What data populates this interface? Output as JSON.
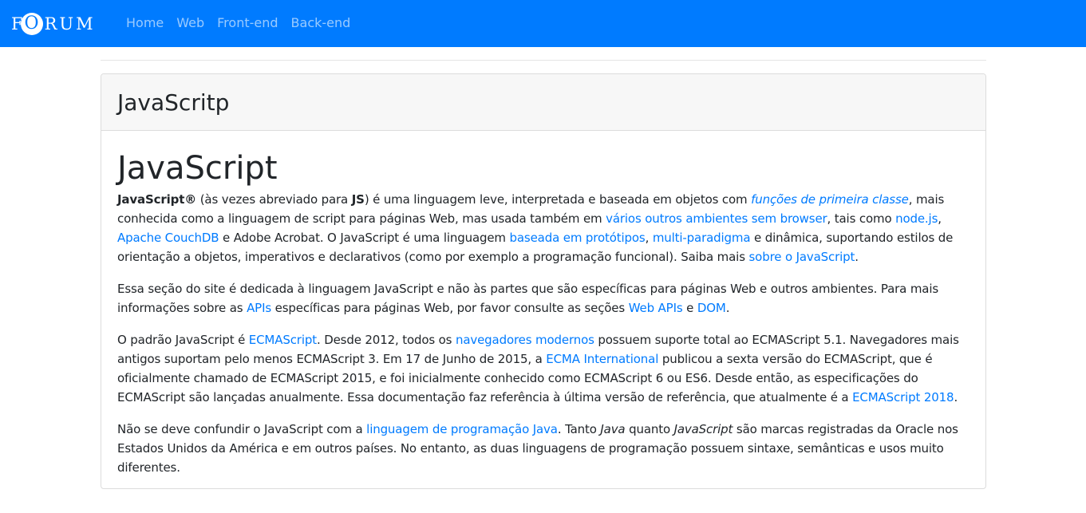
{
  "navbar": {
    "brand_first": "F",
    "brand_circle": "O",
    "brand_rest": "RUM",
    "links": [
      "Home",
      "Web",
      "Front-end",
      "Back-end"
    ],
    "bg_color": "#007bff"
  },
  "card": {
    "header_title": "JavaScritp",
    "heading": "JavaScript",
    "p1": {
      "t1": "JavaScript®",
      "t2": " (às vezes abreviado para ",
      "t3": "JS",
      "t4": ") é uma linguagem leve, interpretada e baseada em objetos com ",
      "l1": "funções de primeira classe",
      "t5": ", mais conhecida como a linguagem de script para páginas Web, mas usada também em ",
      "l2": "vários outros ambientes sem browser",
      "t6": ", tais como ",
      "l3": "node.js",
      "t7": ", ",
      "l4": "Apache CouchDB",
      "t8": " e Adobe Acrobat. O JavaScript é uma linguagem ",
      "l5": "baseada em protótipos",
      "t9": ", ",
      "l6": "multi-paradigma",
      "t10": " e dinâmica, suportando estilos de orientação a objetos, imperativos e declarativos (como por exemplo a programação funcional). Saiba mais ",
      "l7": "sobre o JavaScript",
      "t11": "."
    },
    "p2": {
      "t1": "Essa seção do site é dedicada à linguagem JavaScript e não às partes que são específicas para páginas Web e outros ambientes. Para mais informações sobre as ",
      "l1": "APIs",
      "t2": " específicas para páginas Web, por favor consulte as seções ",
      "l2": "Web APIs",
      "t3": " e ",
      "l3": "DOM",
      "t4": "."
    },
    "p3": {
      "t1": "O padrão JavaScript é ",
      "l1": "ECMAScript",
      "t2": ". Desde 2012, todos os ",
      "l2": "navegadores modernos",
      "t3": " possuem suporte total ao ECMAScript 5.1. Navegadores mais antigos suportam pelo menos ECMAScript 3. Em 17 de Junho de 2015, a ",
      "l3": "ECMA International",
      "t4": " publicou a sexta versão do ECMAScript, que é oficialmente chamado de ECMAScript 2015, e foi inicialmente conhecido como ECMAScript 6 ou ES6. Desde então, as especificações do ECMAScript são lançadas anualmente. Essa documentação faz referência à última versão de referência, que atualmente é a ",
      "l4": "ECMAScript 2018",
      "t5": "."
    },
    "p4": {
      "t1": "Não se deve confundir o JavaScript com a ",
      "l1": "linguagem de programação Java",
      "t2": ". Tanto ",
      "i1": "Java",
      "t3": " quanto ",
      "i2": "JavaScript",
      "t4": " são marcas registradas da Oracle nos Estados Unidos da América e em outros países. No entanto, as duas linguagens de programação possuem sintaxe, semânticas e usos muito diferentes."
    }
  }
}
